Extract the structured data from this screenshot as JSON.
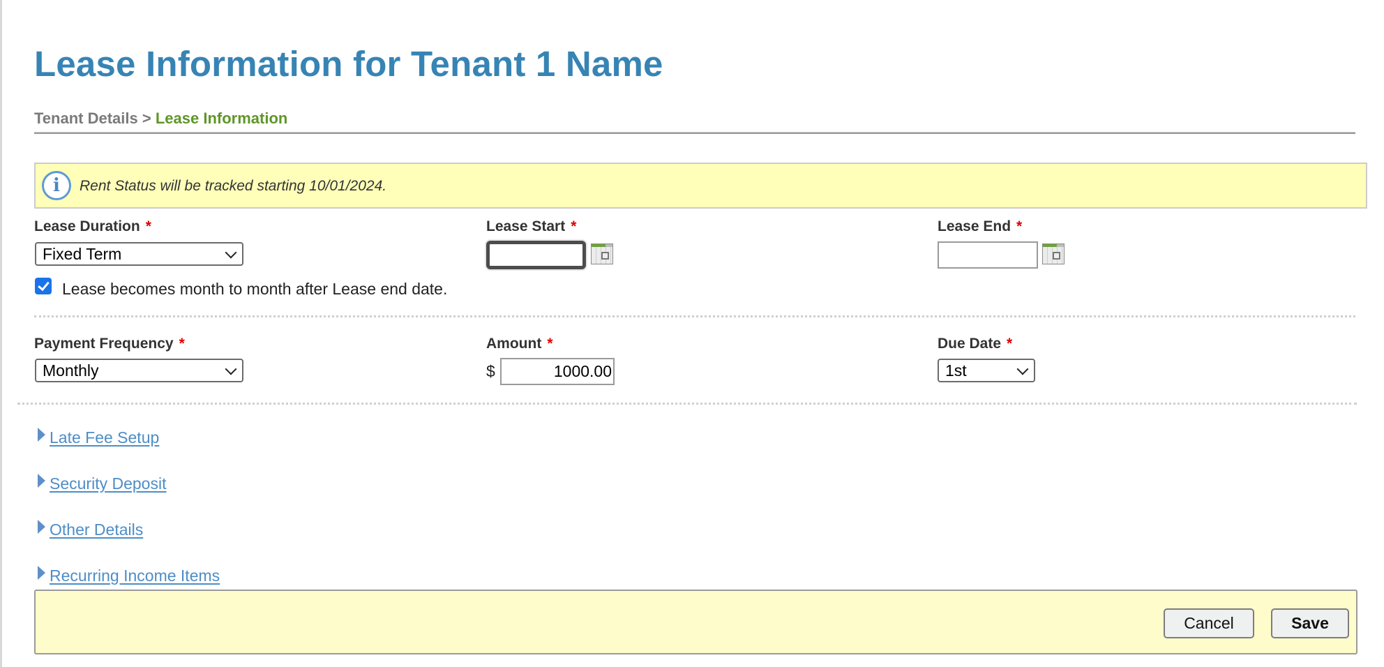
{
  "page": {
    "title": "Lease Information for Tenant 1 Name"
  },
  "breadcrumb": {
    "parent": "Tenant Details",
    "separator": ">",
    "current": "Lease Information"
  },
  "info_banner": {
    "icon": "info-icon",
    "text": "Rent Status will be tracked starting 10/01/2024."
  },
  "lease": {
    "duration": {
      "label": "Lease Duration",
      "required_marker": "*",
      "selected": "Fixed Term"
    },
    "start": {
      "label": "Lease Start",
      "required_marker": "*",
      "value": "",
      "icon": "calendar-icon"
    },
    "end": {
      "label": "Lease End",
      "required_marker": "*",
      "value": "",
      "icon": "calendar-icon"
    },
    "month_to_month": {
      "checked": true,
      "label": "Lease becomes month to month after Lease end date."
    }
  },
  "payment": {
    "frequency": {
      "label": "Payment Frequency",
      "required_marker": "*",
      "selected": "Monthly"
    },
    "amount": {
      "label": "Amount",
      "required_marker": "*",
      "currency_symbol": "$",
      "value": "1000.00"
    },
    "due_date": {
      "label": "Due Date",
      "required_marker": "*",
      "selected": "1st"
    }
  },
  "sections": [
    {
      "label": " Late Fee Setup",
      "icon": "expand-triangle-icon"
    },
    {
      "label": " Security Deposit",
      "icon": "expand-triangle-icon"
    },
    {
      "label": " Other Details",
      "icon": "expand-triangle-icon"
    },
    {
      "label": " Recurring Income Items",
      "icon": "expand-triangle-icon"
    }
  ],
  "footer": {
    "cancel_label": "Cancel",
    "save_label": "Save"
  },
  "colors": {
    "title": "#3784b4",
    "breadcrumb_current": "#5f9628",
    "banner_bg": "#ffffb9",
    "footer_bg": "#fffccb",
    "link": "#4e8dc6",
    "required": "#e00000"
  }
}
